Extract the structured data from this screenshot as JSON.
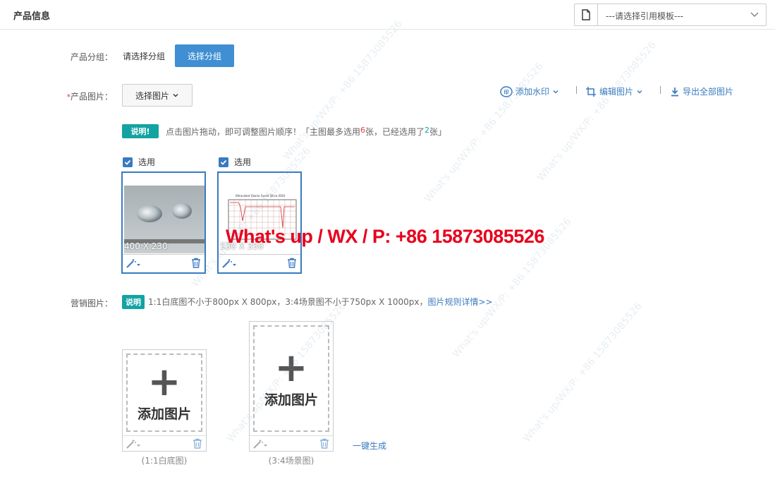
{
  "header": {
    "title": "产品信息",
    "template_placeholder": "---请选择引用模板---"
  },
  "group": {
    "label": "产品分组：",
    "value": "请选择分组",
    "button": "选择分组"
  },
  "product_images": {
    "required_mark": "*",
    "label": "产品图片：",
    "select_button": "选择图片",
    "tools": {
      "watermark": "添加水印",
      "edit": "编辑图片",
      "export": "导出全部图片"
    },
    "note_badge": "说明!",
    "note_pre": "点击图片拖动，即可调整图片顺序！「主图最多选用",
    "note_max": "6",
    "note_mid": "张，已经选用了",
    "note_used": "2",
    "note_post": "张」",
    "items": [
      {
        "check_label": "选用",
        "size": "400 X 230"
      },
      {
        "check_label": "选用",
        "size": "530 X 350"
      }
    ],
    "chart_caption": "Ultraviolet Ozone Fused Silica (ISO)"
  },
  "overlay_text": "What's up / WX / P: +86 15873085526",
  "watermark_text": "What's up/WX/P: +86 15873085526",
  "marketing": {
    "label": "营销图片：",
    "note_badge": "说明",
    "note": "1:1白底图不小于800px X 800px，3:4场景图不小于750px X 1000px，",
    "rules_link": "图片规则详情>>",
    "boxes": [
      {
        "add_text": "添加图片",
        "caption": "(1:1白底图)"
      },
      {
        "add_text": "添加图片",
        "caption": "(3:4场景图)"
      }
    ],
    "one_click": "一键生成"
  }
}
